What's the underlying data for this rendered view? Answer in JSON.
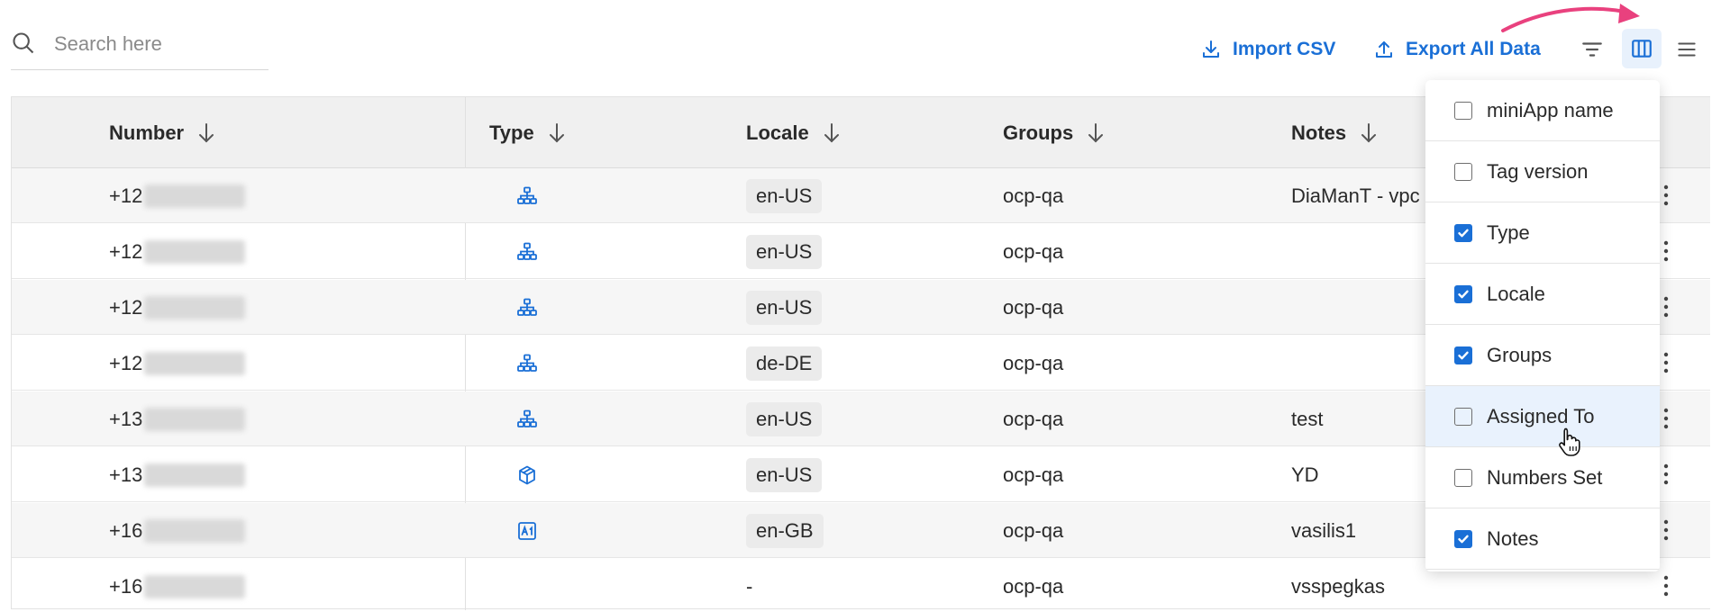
{
  "search": {
    "placeholder": "Search here"
  },
  "toolbar": {
    "import_label": "Import CSV",
    "export_label": "Export All Data",
    "accent": "#1a6fd6",
    "annotation_color": "#e9417e"
  },
  "table": {
    "columns": [
      {
        "label": "Number"
      },
      {
        "label": "Type"
      },
      {
        "label": "Locale"
      },
      {
        "label": "Groups"
      },
      {
        "label": "Notes"
      }
    ],
    "rows": [
      {
        "number": "+12",
        "type_icon": "flow-icon",
        "locale": "en-US",
        "groups": "ocp-qa",
        "notes": "DiaManT - vpc"
      },
      {
        "number": "+12",
        "type_icon": "flow-icon",
        "locale": "en-US",
        "groups": "ocp-qa",
        "notes": ""
      },
      {
        "number": "+12",
        "type_icon": "flow-icon",
        "locale": "en-US",
        "groups": "ocp-qa",
        "notes": ""
      },
      {
        "number": "+12",
        "type_icon": "flow-icon",
        "locale": "de-DE",
        "groups": "ocp-qa",
        "notes": ""
      },
      {
        "number": "+13",
        "type_icon": "flow-icon",
        "locale": "en-US",
        "groups": "ocp-qa",
        "notes": "test"
      },
      {
        "number": "+13",
        "type_icon": "cube-icon",
        "locale": "en-US",
        "groups": "ocp-qa",
        "notes": "YD"
      },
      {
        "number": "+16",
        "type_icon": "ai-box-icon",
        "locale": "en-GB",
        "groups": "ocp-qa",
        "notes": "vasilis1"
      },
      {
        "number": "+16",
        "type_icon": "",
        "locale": "-",
        "groups": "ocp-qa",
        "notes": "vsspegkas"
      }
    ]
  },
  "column_picker": {
    "items": [
      {
        "label": "miniApp name",
        "checked": false
      },
      {
        "label": "Tag version",
        "checked": false
      },
      {
        "label": "Type",
        "checked": true
      },
      {
        "label": "Locale",
        "checked": true
      },
      {
        "label": "Groups",
        "checked": true
      },
      {
        "label": "Assigned To",
        "checked": false
      },
      {
        "label": "Numbers Set",
        "checked": false
      },
      {
        "label": "Notes",
        "checked": true
      }
    ],
    "hovered": "Assigned To"
  }
}
